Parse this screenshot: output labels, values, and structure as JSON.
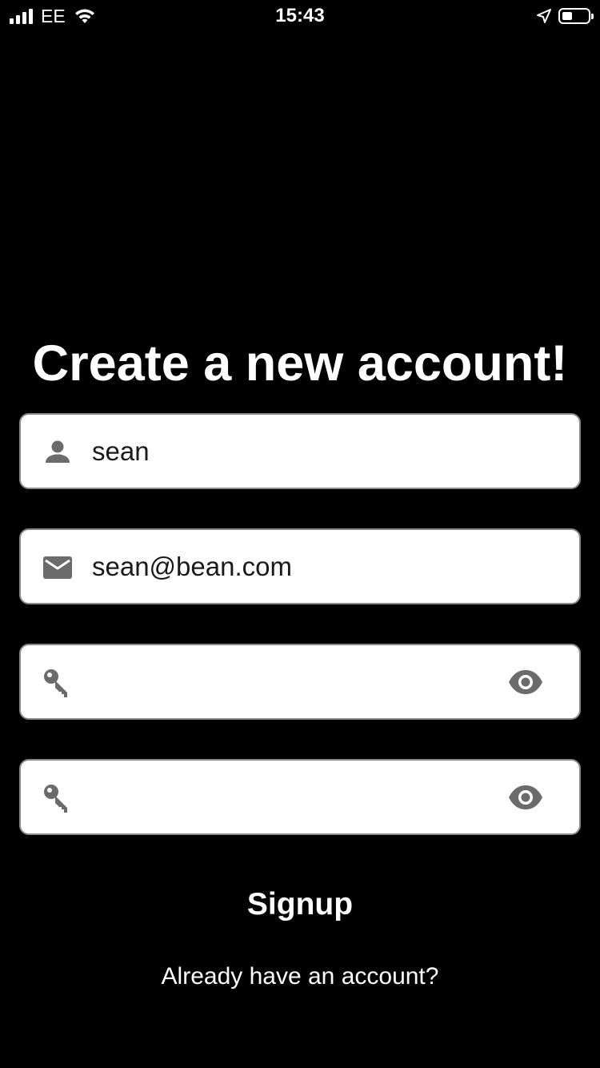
{
  "status_bar": {
    "carrier": "EE",
    "time": "15:43",
    "battery_level": 0.4
  },
  "page": {
    "title": "Create a new account!"
  },
  "form": {
    "username": {
      "value": "sean",
      "icon": "person-icon"
    },
    "email": {
      "value": "sean@bean.com",
      "icon": "mail-icon"
    },
    "password": {
      "value": "",
      "icon": "key-icon",
      "toggle_icon": "eye-icon"
    },
    "confirm_password": {
      "value": "",
      "icon": "key-icon",
      "toggle_icon": "eye-icon"
    },
    "signup_label": "Signup",
    "login_link": "Already have an account?"
  },
  "colors": {
    "background": "#000000",
    "field_background": "#ffffff",
    "field_border": "#8a8a8a",
    "icon_gray": "#6b6b6b",
    "text": "#ffffff"
  }
}
